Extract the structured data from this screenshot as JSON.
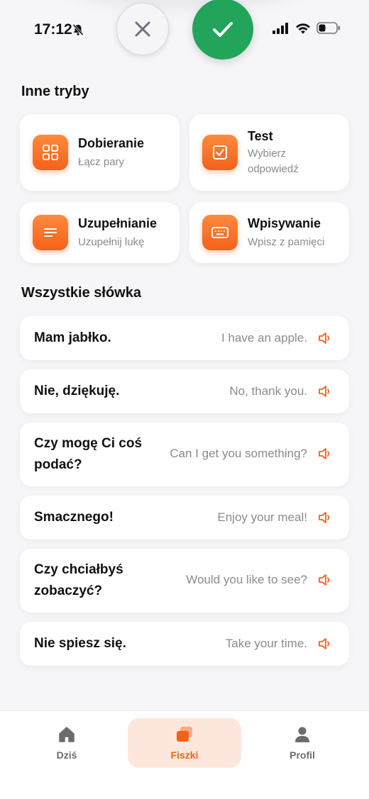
{
  "status_bar": {
    "time": "17:12"
  },
  "section_modes": {
    "title": "Inne tryby"
  },
  "modes": [
    {
      "title": "Dobieranie",
      "subtitle": "Łącz pary",
      "icon": "grid-icon"
    },
    {
      "title": "Test",
      "subtitle": "Wybierz odpowiedź",
      "icon": "checkbox-icon"
    },
    {
      "title": "Uzupełnianie",
      "subtitle": "Uzupełnij lukę",
      "icon": "lines-icon"
    },
    {
      "title": "Wpisywanie",
      "subtitle": "Wpisz z pamięci",
      "icon": "keyboard-icon"
    }
  ],
  "section_words": {
    "title": "Wszystkie słówka"
  },
  "words": [
    {
      "pl": "Mam jabłko.",
      "en": "I have an apple."
    },
    {
      "pl": "Nie, dziękuję.",
      "en": "No, thank you."
    },
    {
      "pl": "Czy mogę Ci coś podać?",
      "en": "Can I get you something?"
    },
    {
      "pl": "Smacznego!",
      "en": "Enjoy your meal!"
    },
    {
      "pl": "Czy chciałbyś zobaczyć?",
      "en": "Would you like to see?"
    },
    {
      "pl": "Nie spiesz się.",
      "en": "Take your time."
    }
  ],
  "nav": [
    {
      "label": "Dziś",
      "icon": "home-icon",
      "active": false
    },
    {
      "label": "Fiszki",
      "icon": "cards-icon",
      "active": true
    },
    {
      "label": "Profil",
      "icon": "person-icon",
      "active": false
    }
  ],
  "colors": {
    "accent": "#f4611a",
    "confirm": "#22a45a",
    "background": "#f6f6f9",
    "muted_text": "#8a8a90"
  }
}
